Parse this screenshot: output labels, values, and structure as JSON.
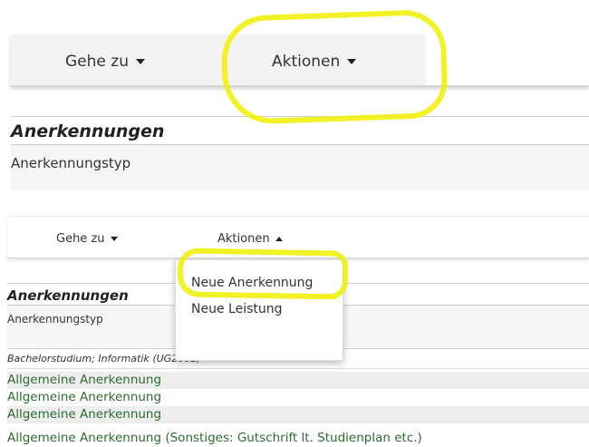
{
  "top_panel": {
    "nav": {
      "goto_label": "Gehe zu",
      "actions_label": "Aktionen"
    },
    "title": "Anerkennungen",
    "subtitle": "Anerkennungstyp"
  },
  "bottom_panel": {
    "nav": {
      "goto_label": "Gehe zu",
      "actions_label": "Aktionen"
    },
    "title": "Anerkennungen",
    "subtitle": "Anerkennungstyp",
    "study_line": "Bachelorstudium; Informatik (UG2002)",
    "rows": [
      "Allgemeine Anerkennung",
      "Allgemeine Anerkennung",
      "Allgemeine Anerkennung",
      "Allgemeine Anerkennung (Sonstiges: Gutschrift lt. Studienplan etc.)"
    ],
    "actions_menu": {
      "items": [
        "Neue Anerkennung",
        "Neue Leistung"
      ]
    }
  },
  "colors": {
    "highlighter": "#f0f000",
    "link_green": "#2d6b2d"
  }
}
